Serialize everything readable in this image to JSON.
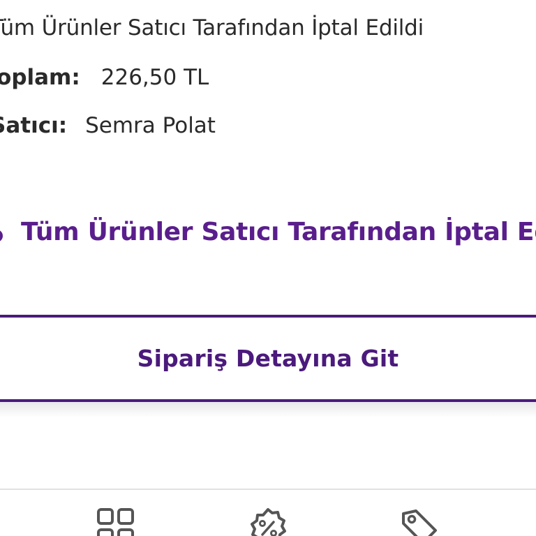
{
  "order": {
    "status_text": "Tüm Ürünler Satıcı Tarafından İptal Edildi",
    "total_label": "Toplam:",
    "total_value": "226,50 TL",
    "seller_label": "Satıcı:",
    "seller_value": "Semra Polat"
  },
  "shipment": {
    "status_text": "Tüm Ürünler Satıcı Tarafından İptal Edildi"
  },
  "actions": {
    "detail_label": "Sipariş Detayına Git"
  },
  "bottom_nav": {
    "items": [
      {
        "icon": "grid-icon"
      },
      {
        "icon": "discount-badge-icon"
      },
      {
        "icon": "tag-icon"
      }
    ]
  },
  "colors": {
    "brand_purple": "#5a1e8c",
    "text_dark": "#2a2a2a",
    "nav_icon": "#555555"
  }
}
